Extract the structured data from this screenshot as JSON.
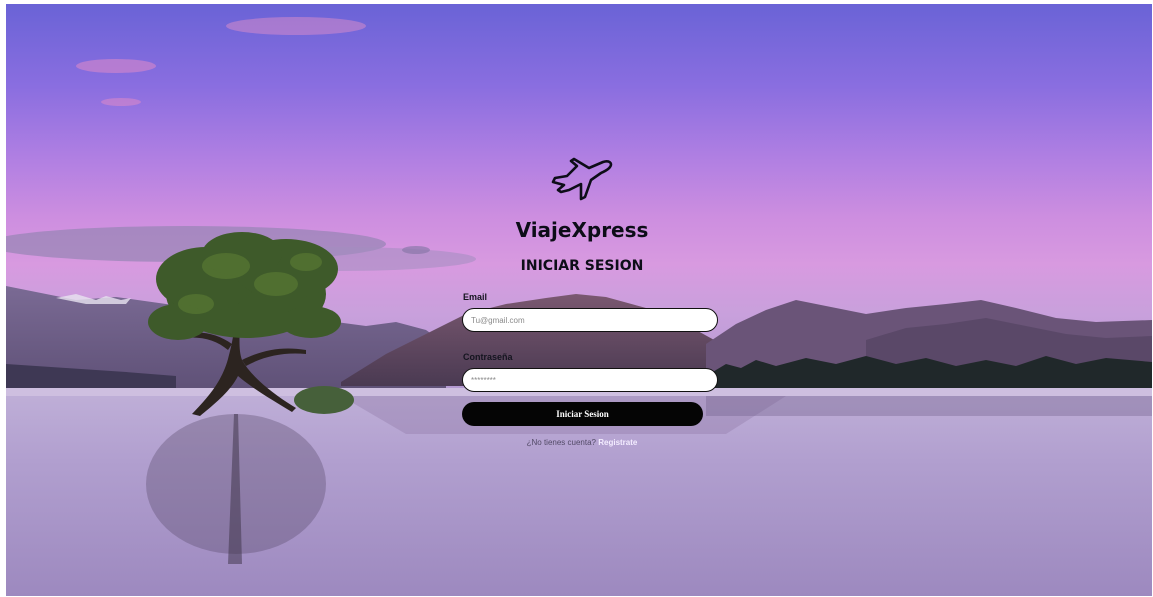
{
  "app": {
    "name": "ViajeXpress",
    "logo_icon": "airplane-icon"
  },
  "login": {
    "heading": "INICIAR SESION",
    "email_label": "Email",
    "email_placeholder": "Tu@gmail.com",
    "password_label": "Contraseña",
    "password_placeholder": "********",
    "submit_label": "Iniciar Sesion",
    "register_prompt": "¿No tienes cuenta?",
    "register_link": "Registrate"
  },
  "colors": {
    "button_bg": "#050505",
    "button_text": "#ffffff",
    "link": "#f3ecff",
    "sky_top": "#6a63d6",
    "sky_mid": "#cd8ee0",
    "lake": "#a88fc6"
  }
}
